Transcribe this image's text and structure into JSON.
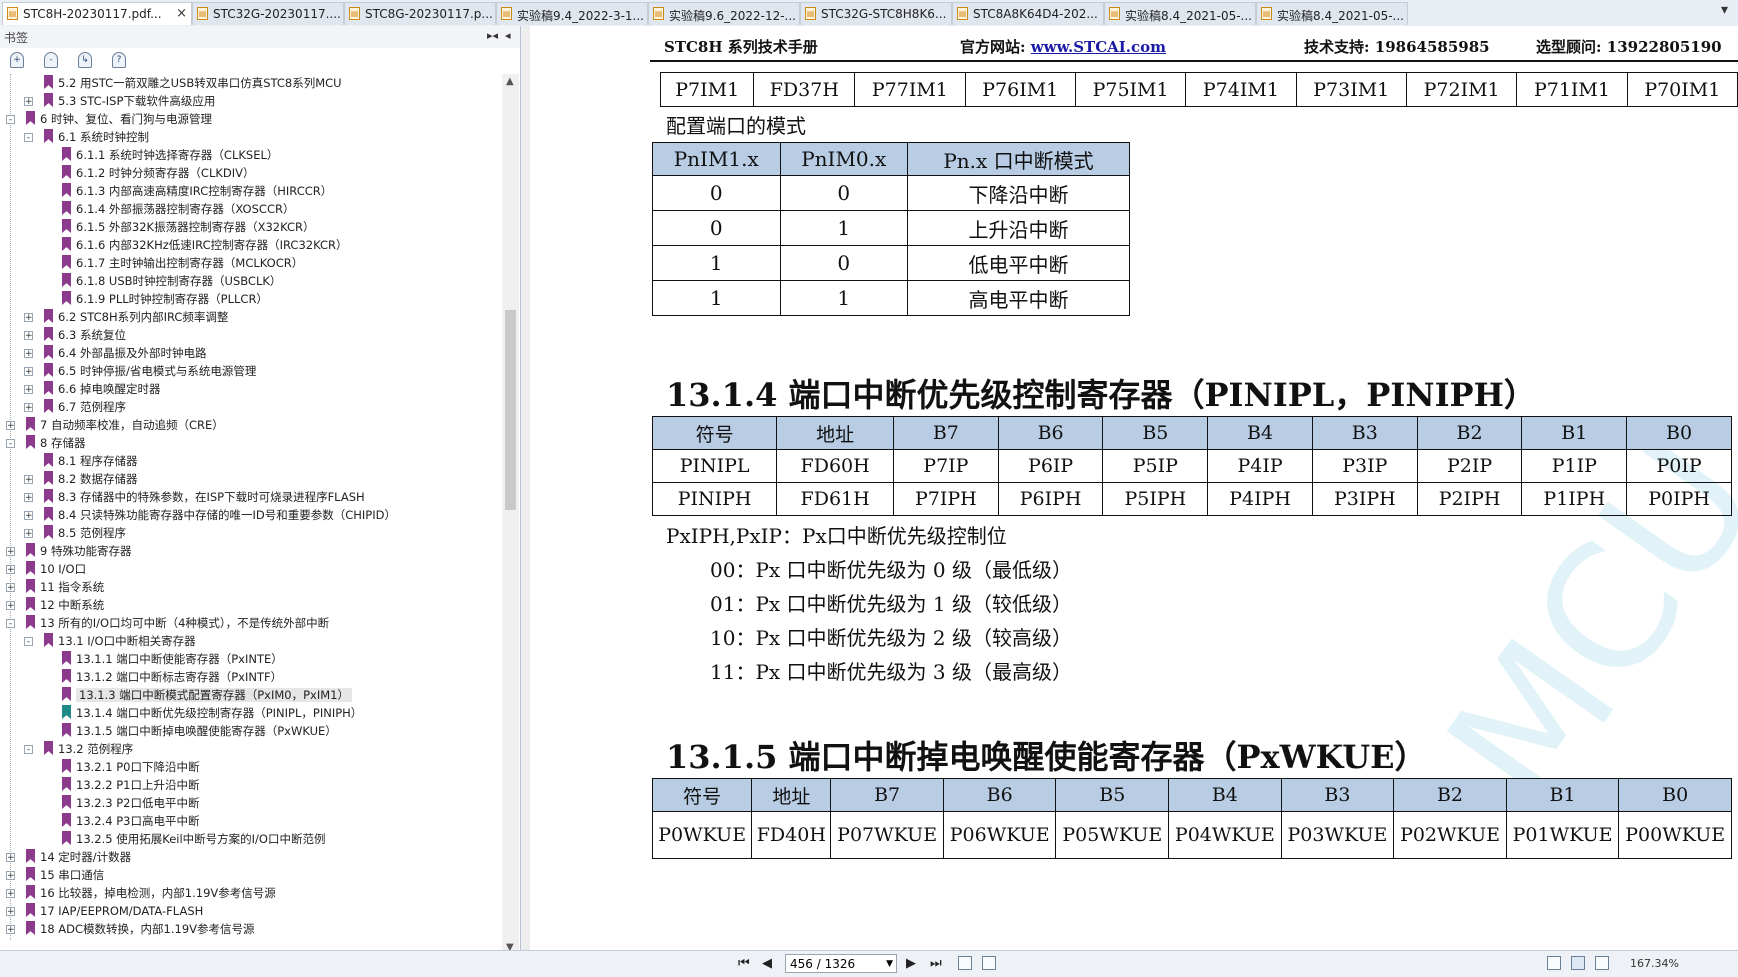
{
  "tabs": [
    {
      "label": "STC8H-20230117.pdf...",
      "active": true,
      "closable": true
    },
    {
      "label": "STC32G-20230117...."
    },
    {
      "label": "STC8G-20230117.p..."
    },
    {
      "label": "实验稿9.4_2022-3-1..."
    },
    {
      "label": "实验稿9.6_2022-12-..."
    },
    {
      "label": "STC32G-STC8H8K6..."
    },
    {
      "label": "STC8A8K64D4-202..."
    },
    {
      "label": "实验稿8.4_2021-05-..."
    },
    {
      "label": "实验稿8.4_2021-05-..."
    }
  ],
  "tab_close_glyph": "×",
  "tab_menu_glyph": "▾",
  "sidebar": {
    "title": "书签",
    "controls": [
      "▸◂",
      "◂"
    ],
    "tree": [
      {
        "label": "5.2 用STC一箭双雕之USB转双串口仿真STC8系列MCU",
        "level": 2,
        "exp": ""
      },
      {
        "label": "5.3 STC-ISP下载软件高级应用",
        "level": 2,
        "exp": "+"
      },
      {
        "label": "6 时钟、复位、看门狗与电源管理",
        "level": 1,
        "exp": "-"
      },
      {
        "label": "6.1 系统时钟控制",
        "level": 2,
        "exp": "-"
      },
      {
        "label": "6.1.1 系统时钟选择寄存器（CLKSEL）",
        "level": 3,
        "exp": ""
      },
      {
        "label": "6.1.2 时钟分频寄存器（CLKDIV）",
        "level": 3,
        "exp": ""
      },
      {
        "label": "6.1.3 内部高速高精度IRC控制寄存器（HIRCCR）",
        "level": 3,
        "exp": ""
      },
      {
        "label": "6.1.4 外部振荡器控制寄存器（XOSCCR）",
        "level": 3,
        "exp": ""
      },
      {
        "label": "6.1.5 外部32K振荡器控制寄存器（X32KCR）",
        "level": 3,
        "exp": ""
      },
      {
        "label": "6.1.6 内部32KHz低速IRC控制寄存器（IRC32KCR）",
        "level": 3,
        "exp": ""
      },
      {
        "label": "6.1.7 主时钟输出控制寄存器（MCLKOCR）",
        "level": 3,
        "exp": ""
      },
      {
        "label": "6.1.8 USB时钟控制寄存器（USBCLK）",
        "level": 3,
        "exp": ""
      },
      {
        "label": "6.1.9 PLL时钟控制寄存器（PLLCR）",
        "level": 3,
        "exp": ""
      },
      {
        "label": "6.2 STC8H系列内部IRC频率调整",
        "level": 2,
        "exp": "+"
      },
      {
        "label": "6.3 系统复位",
        "level": 2,
        "exp": "+"
      },
      {
        "label": "6.4 外部晶振及外部时钟电路",
        "level": 2,
        "exp": "+"
      },
      {
        "label": "6.5 时钟停振/省电模式与系统电源管理",
        "level": 2,
        "exp": "+"
      },
      {
        "label": "6.6 掉电唤醒定时器",
        "level": 2,
        "exp": "+"
      },
      {
        "label": "6.7 范例程序",
        "level": 2,
        "exp": "+"
      },
      {
        "label": "7 自动频率校准，自动追频（CRE）",
        "level": 1,
        "exp": "+"
      },
      {
        "label": "8 存储器",
        "level": 1,
        "exp": "-"
      },
      {
        "label": "8.1 程序存储器",
        "level": 2,
        "exp": ""
      },
      {
        "label": "8.2 数据存储器",
        "level": 2,
        "exp": "+"
      },
      {
        "label": "8.3 存储器中的特殊参数，在ISP下载时可烧录进程序FLASH",
        "level": 2,
        "exp": "+"
      },
      {
        "label": "8.4 只读特殊功能寄存器中存储的唯一ID号和重要参数（CHIPID）",
        "level": 2,
        "exp": "+"
      },
      {
        "label": "8.5 范例程序",
        "level": 2,
        "exp": "+"
      },
      {
        "label": "9 特殊功能寄存器",
        "level": 1,
        "exp": "+"
      },
      {
        "label": "10 I/O口",
        "level": 1,
        "exp": "+"
      },
      {
        "label": "11 指令系统",
        "level": 1,
        "exp": "+"
      },
      {
        "label": "12 中断系统",
        "level": 1,
        "exp": "+"
      },
      {
        "label": "13 所有的I/O口均可中断（4种模式），不是传统外部中断",
        "level": 1,
        "exp": "-"
      },
      {
        "label": "13.1 I/O口中断相关寄存器",
        "level": 2,
        "exp": "-"
      },
      {
        "label": "13.1.1 端口中断使能寄存器（PxINTE）",
        "level": 3,
        "exp": ""
      },
      {
        "label": "13.1.2 端口中断标志寄存器（PxINTF）",
        "level": 3,
        "exp": ""
      },
      {
        "label": "13.1.3 端口中断模式配置寄存器（PxIM0，PxIM1）",
        "level": 3,
        "exp": "",
        "selected": true
      },
      {
        "label": "13.1.4 端口中断优先级控制寄存器（PINIPL，PINIPH）",
        "level": 3,
        "exp": "",
        "teal": true
      },
      {
        "label": "13.1.5 端口中断掉电唤醒使能寄存器（PxWKUE）",
        "level": 3,
        "exp": ""
      },
      {
        "label": "13.2 范例程序",
        "level": 2,
        "exp": "-"
      },
      {
        "label": "13.2.1 P0口下降沿中断",
        "level": 3,
        "exp": ""
      },
      {
        "label": "13.2.2 P1口上升沿中断",
        "level": 3,
        "exp": ""
      },
      {
        "label": "13.2.3 P2口低电平中断",
        "level": 3,
        "exp": ""
      },
      {
        "label": "13.2.4 P3口高电平中断",
        "level": 3,
        "exp": ""
      },
      {
        "label": "13.2.5 使用拓展Keil中断号方案的I/O口中断范例",
        "level": 3,
        "exp": ""
      },
      {
        "label": "14 定时器/计数器",
        "level": 1,
        "exp": "+"
      },
      {
        "label": "15 串口通信",
        "level": 1,
        "exp": "+"
      },
      {
        "label": "16 比较器，掉电检测，内部1.19V参考信号源",
        "level": 1,
        "exp": "+"
      },
      {
        "label": "17 IAP/EEPROM/DATA-FLASH",
        "level": 1,
        "exp": "+"
      },
      {
        "label": "18 ADC模数转换，内部1.19V参考信号源",
        "level": 1,
        "exp": "+"
      }
    ]
  },
  "doc": {
    "header": {
      "title": "STC8H 系列技术手册",
      "site_label": "官方网站: ",
      "site_url": "www.STCAI.com",
      "support": "技术支持: 19864585985",
      "consult": "选型顾问: 13922805190"
    },
    "p7im1_row": [
      "P7IM1",
      "FD37H",
      "P77IM1",
      "P76IM1",
      "P75IM1",
      "P74IM1",
      "P73IM1",
      "P72IM1",
      "P71IM1",
      "P70IM1"
    ],
    "mode_caption": "配置端口的模式",
    "mode_table": {
      "headers": [
        "PnIM1.x",
        "PnIM0.x",
        "Pn.x 口中断模式"
      ],
      "rows": [
        [
          "0",
          "0",
          "下降沿中断"
        ],
        [
          "0",
          "1",
          "上升沿中断"
        ],
        [
          "1",
          "0",
          "低电平中断"
        ],
        [
          "1",
          "1",
          "高电平中断"
        ]
      ]
    },
    "sec_1314": "13.1.4  端口中断优先级控制寄存器（PINIPL，PINIPH）",
    "pinip_table": {
      "headers": [
        "符号",
        "地址",
        "B7",
        "B6",
        "B5",
        "B4",
        "B3",
        "B2",
        "B1",
        "B0"
      ],
      "rows": [
        [
          "PINIPL",
          "FD60H",
          "P7IP",
          "P6IP",
          "P5IP",
          "P4IP",
          "P3IP",
          "P2IP",
          "P1IP",
          "P0IP"
        ],
        [
          "PINIPH",
          "FD61H",
          "P7IPH",
          "P6IPH",
          "P5IPH",
          "P4IPH",
          "P3IPH",
          "P2IPH",
          "P1IPH",
          "P0IPH"
        ]
      ]
    },
    "pxip_desc": "PxIPH,PxIP：Px口中断优先级控制位",
    "levels": [
      "00：Px 口中断优先级为 0 级（最低级）",
      "01：Px 口中断优先级为 1 级（较低级）",
      "10：Px 口中断优先级为 2 级（较高级）",
      "11：Px 口中断优先级为 3 级（最高级）"
    ],
    "sec_1315": "13.1.5  端口中断掉电唤醒使能寄存器（PxWKUE）",
    "wkue_table": {
      "headers": [
        "符号",
        "地址",
        "B7",
        "B6",
        "B5",
        "B4",
        "B3",
        "B2",
        "B1",
        "B0"
      ],
      "rows": [
        [
          "P0WKUE",
          "FD40H",
          "P07WKUE",
          "P06WKUE",
          "P05WKUE",
          "P04WKUE",
          "P03WKUE",
          "P02WKUE",
          "P01WKUE",
          "P00WKUE"
        ]
      ]
    },
    "watermark": "MCU"
  },
  "status": {
    "page_value": "456 / 1326",
    "zoom": "167.34%",
    "nav": [
      "⏮",
      "◀",
      "▶",
      "⏭"
    ]
  }
}
